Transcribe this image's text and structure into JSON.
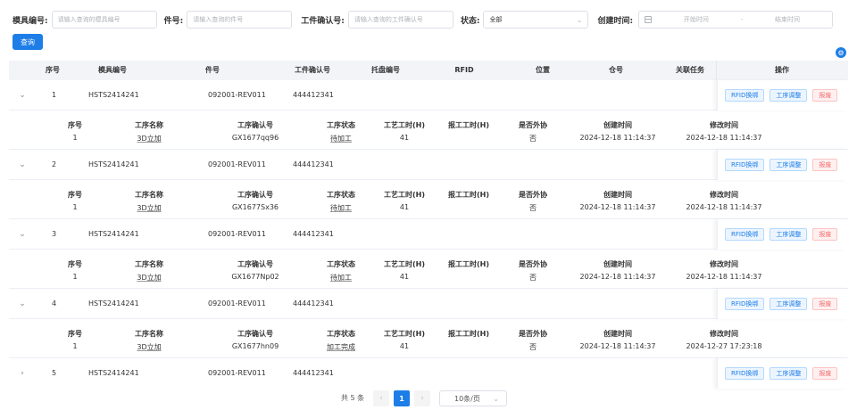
{
  "filters": {
    "mold_label": "模具编号:",
    "mold_placeholder": "请输入查询的模具编号",
    "part_label": "件号:",
    "part_placeholder": "请输入查询的件号",
    "confirm_label": "工件确认号:",
    "confirm_placeholder": "请输入查询的工件确认号",
    "status_label": "状态:",
    "status_value": "全部",
    "created_label": "创建时间:",
    "start_placeholder": "开始时间",
    "range_sep": "-",
    "end_placeholder": "结束时间"
  },
  "query_button": "查询",
  "table": {
    "headers": [
      "序号",
      "模具编号",
      "件号",
      "工件确认号",
      "托盘编号",
      "RFID",
      "位置",
      "仓号",
      "关联任务",
      "操作"
    ],
    "detail_headers": [
      "序号",
      "工序名称",
      "工序确认号",
      "工序状态",
      "工艺工时(H)",
      "报工工时(H)",
      "是否外协",
      "创建时间",
      "修改时间"
    ],
    "ops": [
      "RFID换绑",
      "工序调整",
      "报废"
    ],
    "rows": [
      {
        "expand_icon": "⌄",
        "index": "1",
        "mold": "HSTS2414241",
        "part": "092001-REV011",
        "confirm": "444412341",
        "detail": {
          "index": "1",
          "name": "3D立加",
          "confirm": "GX1677qq96",
          "status": "待加工",
          "hours": "41",
          "report_hours": "",
          "outsource": "否",
          "created": "2024-12-18 11:14:37",
          "modified": "2024-12-18 11:14:37"
        }
      },
      {
        "expand_icon": "⌄",
        "index": "2",
        "mold": "HSTS2414241",
        "part": "092001-REV011",
        "confirm": "444412341",
        "detail": {
          "index": "1",
          "name": "3D立加",
          "confirm": "GX1677Sx36",
          "status": "待加工",
          "hours": "41",
          "report_hours": "",
          "outsource": "否",
          "created": "2024-12-18 11:14:37",
          "modified": "2024-12-18 11:14:37"
        }
      },
      {
        "expand_icon": "⌄",
        "index": "3",
        "mold": "HSTS2414241",
        "part": "092001-REV011",
        "confirm": "444412341",
        "detail": {
          "index": "1",
          "name": "3D立加",
          "confirm": "GX1677Np02",
          "status": "待加工",
          "hours": "41",
          "report_hours": "",
          "outsource": "否",
          "created": "2024-12-18 11:14:37",
          "modified": "2024-12-18 11:14:37"
        }
      },
      {
        "expand_icon": "⌄",
        "index": "4",
        "mold": "HSTS2414241",
        "part": "092001-REV011",
        "confirm": "444412341",
        "detail": {
          "index": "1",
          "name": "3D立加",
          "confirm": "GX1677hn09",
          "status": "加工完成",
          "hours": "41",
          "report_hours": "",
          "outsource": "否",
          "created": "2024-12-18 11:14:37",
          "modified": "2024-12-27 17:23:18"
        }
      },
      {
        "expand_icon": "›",
        "index": "5",
        "mold": "HSTS2414241",
        "part": "092001-REV011",
        "confirm": "444412341"
      }
    ]
  },
  "pagination": {
    "total": "共 5 条",
    "prev_icon": "‹",
    "page": "1",
    "next_icon": "›",
    "page_size": "10条/页"
  }
}
